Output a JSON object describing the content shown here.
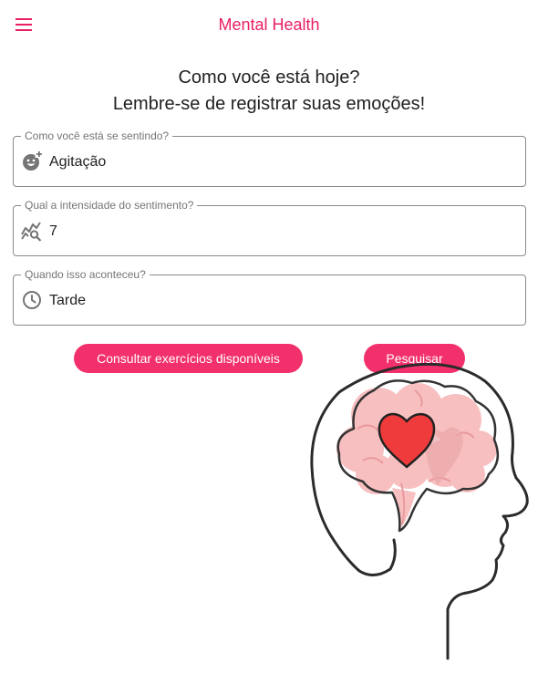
{
  "app": {
    "title": "Mental Health",
    "menu_icon": "menu-icon",
    "accent_color": "#e91e63"
  },
  "heading": {
    "line1": "Como você está hoje?",
    "line2": "Lembre-se de registrar suas emoções!"
  },
  "form": {
    "feeling": {
      "label": "Como você está se sentindo?",
      "value": "Agitação",
      "icon": "add-reaction-icon"
    },
    "intensity": {
      "label": "Qual a intensidade do sentimento?",
      "value": "7",
      "icon": "query-stats-icon"
    },
    "when": {
      "label": "Quando isso aconteceu?",
      "value": "Tarde",
      "icon": "clock-icon"
    }
  },
  "actions": {
    "exercises_label": "Consultar exercícios disponíveis",
    "search_label": "Pesquisar",
    "button_color": "#f2306b"
  },
  "illustration": {
    "name": "head-brain-heart-illustration"
  }
}
